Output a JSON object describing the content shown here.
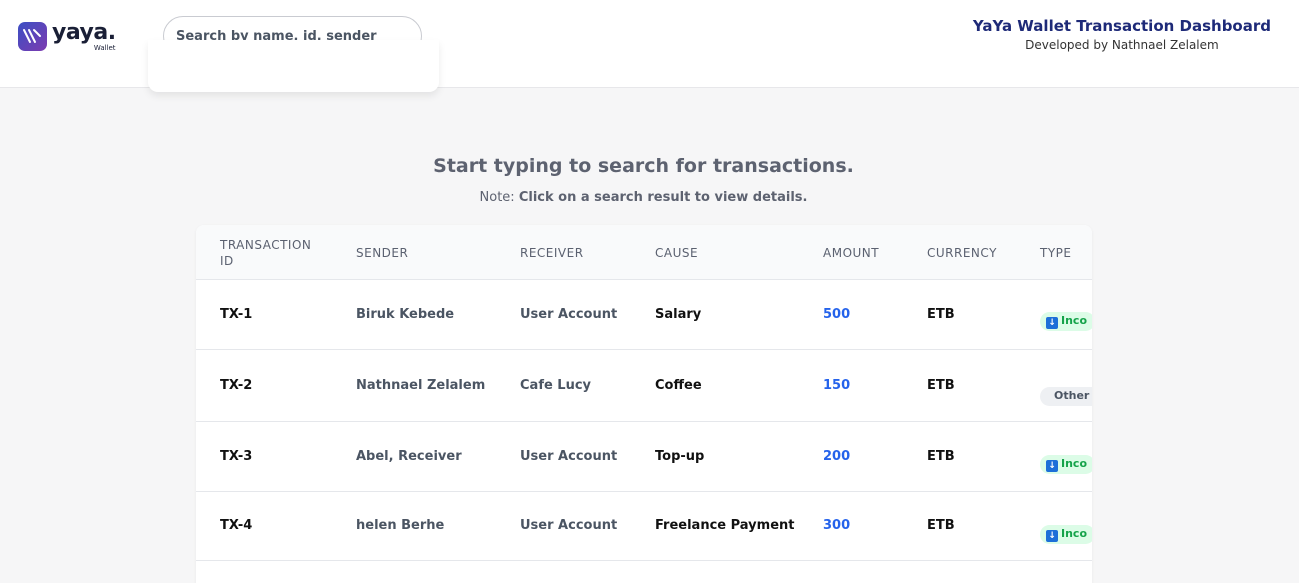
{
  "header": {
    "logo_word": "yaya.",
    "logo_sub": "Wallet",
    "search_placeholder": "Search by name, id, sender",
    "title": "YaYa Wallet Transaction Dashboard",
    "subtitle": "Developed by Nathnael Zelalem"
  },
  "main": {
    "prompt": "Start typing to search for transactions.",
    "note_prefix": "Note:",
    "note_text": "Click on a search result to view details."
  },
  "table": {
    "columns": [
      "TRANSACTION ID",
      "SENDER",
      "RECEIVER",
      "CAUSE",
      "AMOUNT",
      "CURRENCY",
      "TYPE"
    ],
    "rows": [
      {
        "id": "TX-1",
        "sender": "Biruk Kebede",
        "receiver": "User Account",
        "cause": "Salary",
        "amount": "500",
        "currency": "ETB",
        "type": "Inco",
        "type_icon": "down-arrow-icon"
      },
      {
        "id": "TX-2",
        "sender": "Nathnael Zelalem",
        "receiver": "Cafe Lucy",
        "cause": "Coffee",
        "amount": "150",
        "currency": "ETB",
        "type": "Other",
        "type_icon": ""
      },
      {
        "id": "TX-3",
        "sender": "Abel, Receiver",
        "receiver": "User Account",
        "cause": "Top-up",
        "amount": "200",
        "currency": "ETB",
        "type": "Inco",
        "type_icon": "down-arrow-icon"
      },
      {
        "id": "TX-4",
        "sender": "helen Berhe",
        "receiver": "User Account",
        "cause": "Freelance Payment",
        "amount": "300",
        "currency": "ETB",
        "type": "Inco",
        "type_icon": "down-arrow-icon"
      }
    ]
  },
  "colors": {
    "brand_title": "#1e2a78",
    "amount": "#2563eb",
    "incoming_badge": "#dcfce7",
    "incoming_text": "#15a34a"
  }
}
